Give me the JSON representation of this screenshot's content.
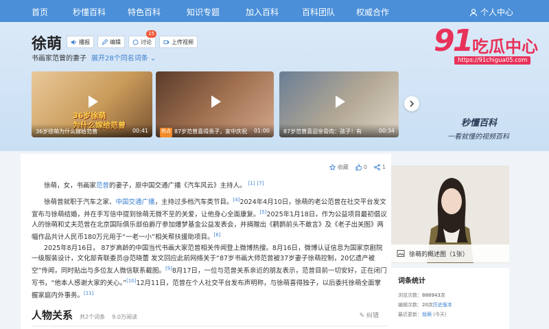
{
  "nav": {
    "items": [
      "首页",
      "秒懂百科",
      "特色百科",
      "知识专题",
      "加入百科",
      "百科团队",
      "权威合作"
    ],
    "user": "个人中心"
  },
  "entry": {
    "title": "徐萌",
    "subtitle": "书画家范曾的妻子",
    "expand": "展开28个同名词条",
    "buttons": {
      "read": "播报",
      "edit": "编辑",
      "discuss": "讨论",
      "discuss_count": "15",
      "upload": "上传视频"
    }
  },
  "logo": {
    "big": "91",
    "cn": "吃瓜中心",
    "url": "https://91chigua05.com"
  },
  "videos": [
    {
      "title": "36岁徐萌为什么嫁给范曾",
      "duration": "00:41",
      "overlay_1": "36岁徐萌",
      "overlay_2": "为什么嫁给范曾"
    },
    {
      "tag": "热点",
      "title": "87岁范曾喜得贵子，家中庆祝",
      "duration": "01:00"
    },
    {
      "title": "87岁范曾喜迎亲骨肉：孩子！有",
      "duration": "00:34"
    }
  ],
  "miaodong": {
    "brand": "秒懂百科",
    "slogan": "一看就懂的视频百科"
  },
  "actions": {
    "collect": "收藏",
    "like_count": "0",
    "share_count": "1"
  },
  "content": {
    "p1": {
      "t1": "徐萌，女，书画家",
      "link": "范曾",
      "t2": "的妻子，原中国交通广播《汽车风云》主持人。",
      "r1": "[1]",
      "r2": "[7]"
    },
    "p2": {
      "t1": "徐萌曾就职于汽车之家、",
      "link": "中国交通广播",
      "t2": "，主持过多档汽车类节目。",
      "r1": "[4]",
      "t3": "2024年4月10日，徐萌的老公范曾在社交平台发文宣布与徐萌结婚，并在手写信中提到徐萌无微不至的关爱，让他身心全面康复。",
      "r2": "[5]",
      "t4": "2025年1月18日，作为公益项目最初倡议人的徐萌和丈夫范曾在北京国际俱乐部伯爵厅参加爆梦基金公益发表会，并捐赠出《鹳鹊前头不敢言》及《老子出关图》两幅作品共计人民币180万元用于“一老一小”相关帮扶援助项目。",
      "r3": "[6]"
    },
    "p3": {
      "t1": "2025年8月16日， 87岁高龄的中国当代书画大家范曾相关传闻登上微博热搜。8月16日，微博认证信息为国家京剧院一级服装设计，文化部青联委员@范晓蕾 发文回应此前网络关于“87岁书画大师范曾被37岁妻子徐萌控制，20亿遗产被空”传闻，同时贴出与多位友人微信联系截图。",
      "r1": "[9]",
      "t2": "8月17日，一位与范曾关系亲近的朋友表示，范曾目前一切安好，正在闭门写书，“他本人感谢大家的关心。”",
      "r2": "[10]",
      "t3": "12月11日，范曾在个人社交平台发布声明称，与徐萌喜得独子，以后委托徐萌全面掌握家庭内外事务。",
      "r3": "[11]"
    }
  },
  "relations": {
    "title": "人物关系",
    "count": "共2个词条",
    "views": "9.0万阅读",
    "edit": "纠错"
  },
  "photo": {
    "caption": "徐萌的概述图（1张）"
  },
  "stats": {
    "title": "词条统计",
    "views_label": "浏览次数：",
    "views_value": "888943次",
    "edits_label": "编辑次数：",
    "edits_value": "20次",
    "history": "历史版本",
    "updated_label": "最近更新：",
    "updated_user": "就萌",
    "updated_when": "(今天)"
  },
  "colors": {
    "nav_bg": "#4a8fd8",
    "link": "#3a7fd0",
    "logo": "#e8325a",
    "badge": "#f05a3a"
  }
}
